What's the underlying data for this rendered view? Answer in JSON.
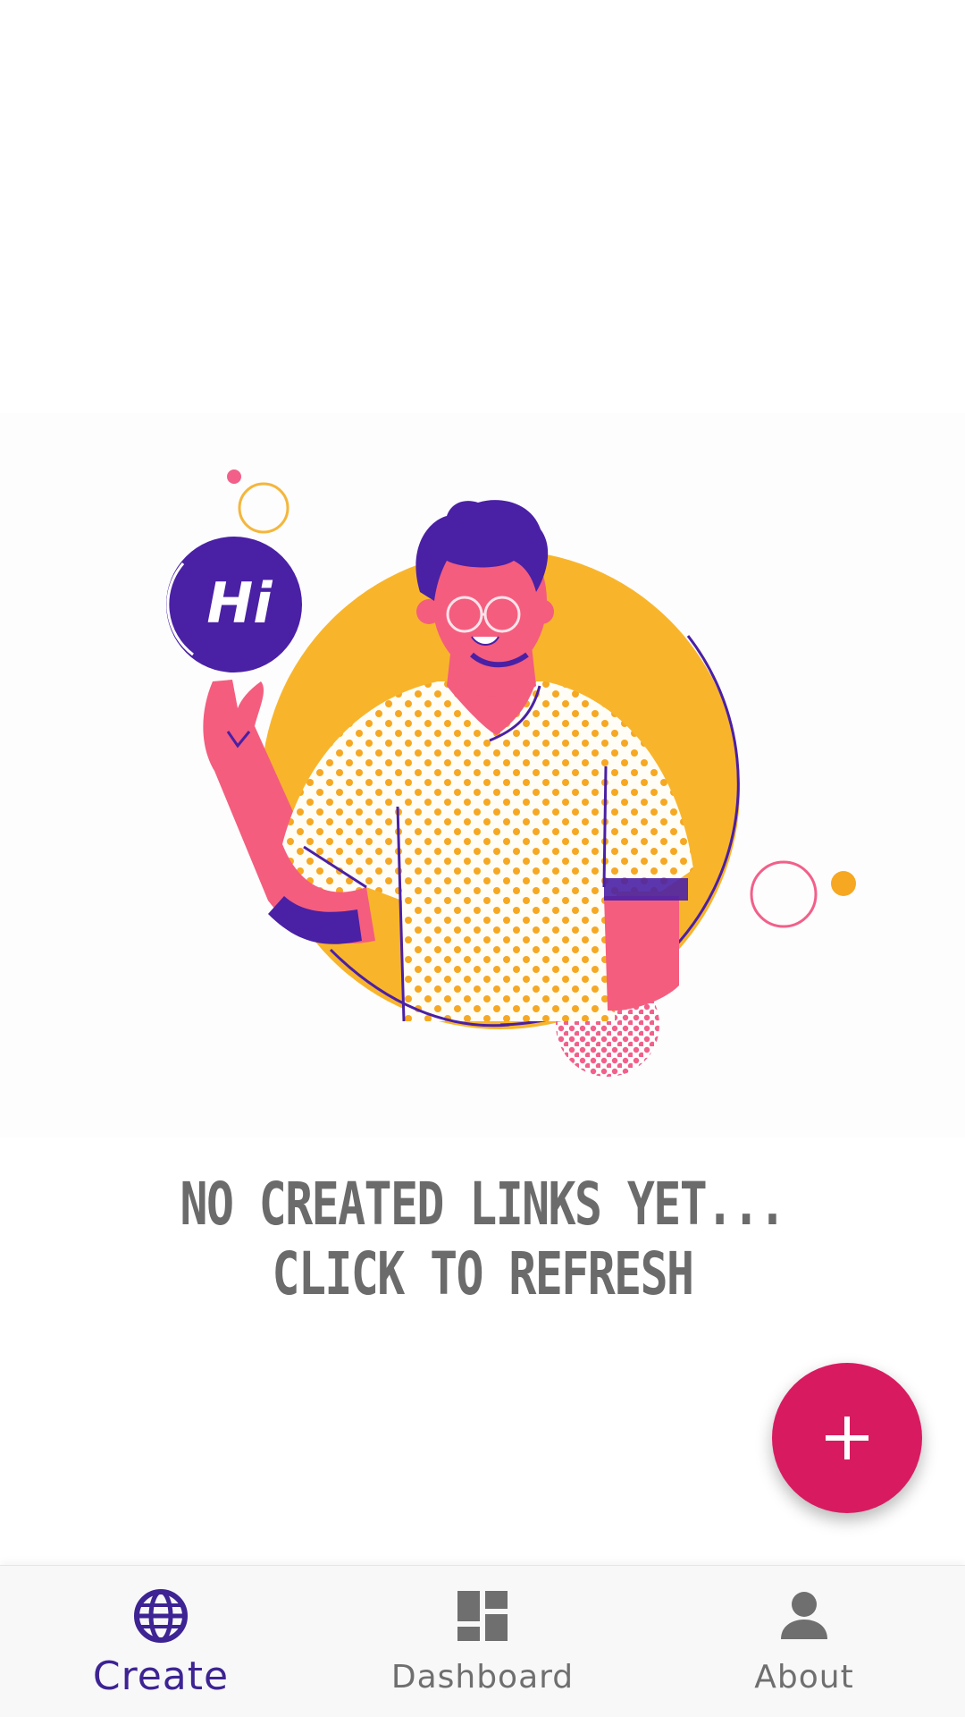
{
  "empty_state": {
    "line1": "NO CREATED LINKS YET...",
    "line2": "CLICK TO REFRESH",
    "greeting": "Hi"
  },
  "fab": {
    "icon": "plus-icon",
    "color": "#d81b60"
  },
  "bottom_nav": {
    "active_color": "#3d2393",
    "inactive_color": "#6f6f6f",
    "items": [
      {
        "label": "Create",
        "icon": "globe-icon",
        "active": true
      },
      {
        "label": "Dashboard",
        "icon": "dashboard-icon",
        "active": false
      },
      {
        "label": "About",
        "icon": "person-icon",
        "active": false
      }
    ]
  }
}
